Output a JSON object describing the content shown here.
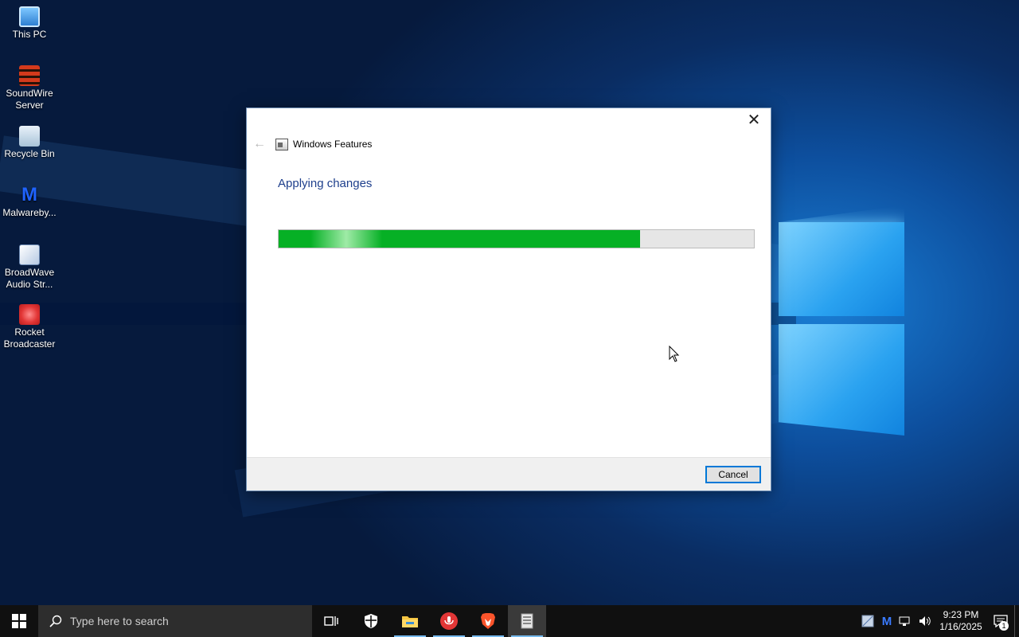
{
  "desktop": {
    "icons": [
      {
        "label": "This PC",
        "icon": "this-pc-icon"
      },
      {
        "label": "SoundWire Server",
        "icon": "soundwire-icon"
      },
      {
        "label": "Recycle Bin",
        "icon": "recycle-bin-icon"
      },
      {
        "label": "Malwareby...",
        "icon": "malwarebytes-icon"
      },
      {
        "label": "BroadWave Audio Str...",
        "icon": "broadwave-icon"
      },
      {
        "label": "Rocket Broadcaster",
        "icon": "rocket-broadcaster-icon"
      }
    ]
  },
  "dialog": {
    "title": "Windows Features",
    "heading": "Applying changes",
    "progress_fraction": 0.76,
    "close_glyph": "✕",
    "back_glyph": "←",
    "cancel_label": "Cancel"
  },
  "taskbar": {
    "search_placeholder": "Type here to search",
    "apps": [
      "task-view",
      "windows-security",
      "file-explorer",
      "rocket-broadcaster",
      "brave-browser",
      "windows-features"
    ],
    "clock_time": "9:23 PM",
    "clock_date": "1/16/2025",
    "notification_count": "1"
  },
  "colors": {
    "progress_fill": "#06b025",
    "heading_blue": "#1e3f8c",
    "accent": "#0078d7"
  }
}
